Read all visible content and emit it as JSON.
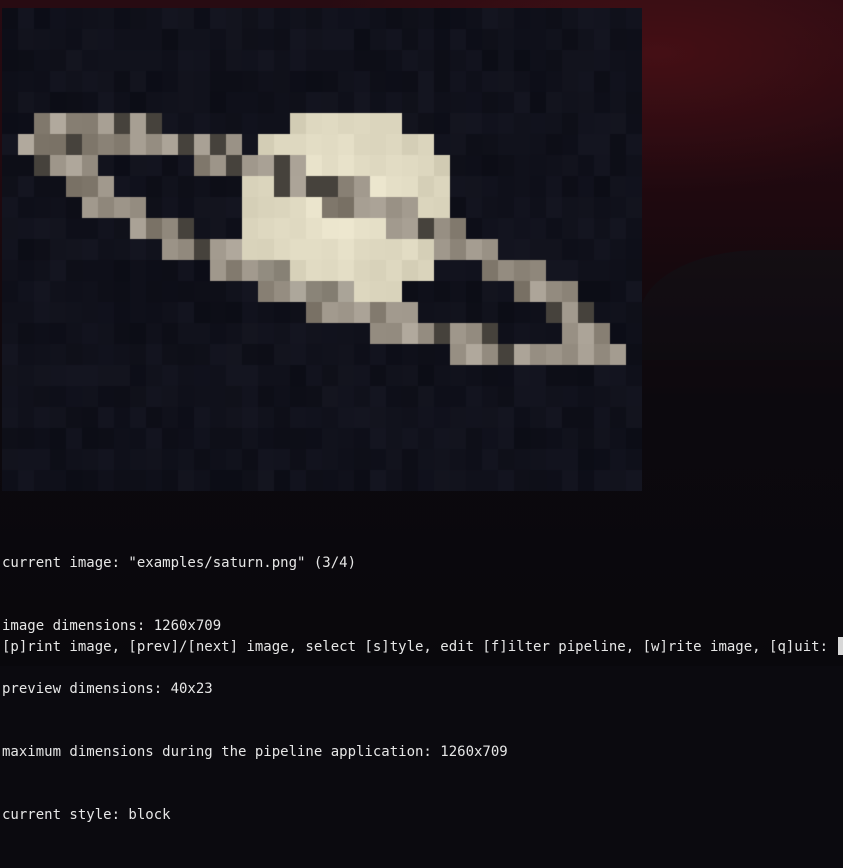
{
  "colors": {
    "terminal_text": "#e6e6e6",
    "cursor": "#d8d8d8",
    "preview_background": "#0c0d14"
  },
  "preview": {
    "image_content": "pixelated-saturn",
    "grid_columns": 40,
    "grid_rows": 23
  },
  "status": {
    "current_image": "current image: \"examples/saturn.png\" (3/4)",
    "image_dimensions": "image dimensions: 1260x709",
    "preview_dimensions": "preview dimensions: 40x23",
    "max_dimensions": "maximum dimensions during the pipeline application: 1260x709",
    "current_style": "current style: block"
  },
  "prompt": {
    "text": "[p]rint image, [prev]/[next] image, select [s]tyle, edit [f]ilter pipeline, [w]rite image, [q]uit: "
  }
}
